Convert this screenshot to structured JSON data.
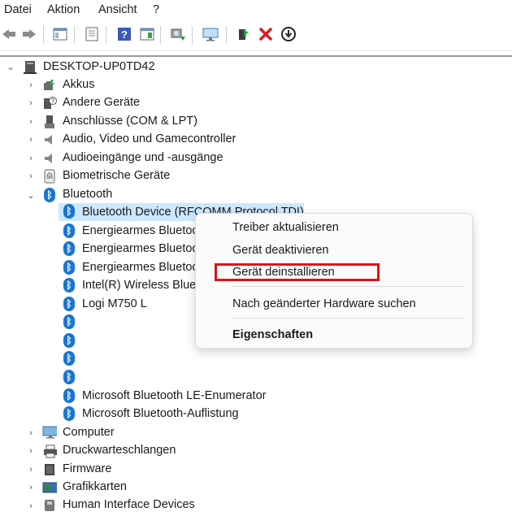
{
  "menu": [
    "Datei",
    "Aktion",
    "Ansicht",
    "?"
  ],
  "tree": {
    "root": "DESKTOP-UP0TD42",
    "categories_before": [
      "Akkus",
      "Andere Geräte",
      "Anschlüsse (COM & LPT)",
      "Audio, Video und Gamecontroller",
      "Audioeingänge und -ausgänge",
      "Biometrische Geräte"
    ],
    "bluetooth": "Bluetooth",
    "bt_children": [
      "Bluetooth Device (RFCOMM Protocol TDI)",
      "Energiearmes Bluetoo",
      "Energiearmes Bluetoo",
      "Energiearmes Bluetoo",
      "Intel(R) Wireless Bluet",
      "Logi M750 L",
      "",
      "",
      "",
      "",
      "Microsoft Bluetooth LE-Enumerator",
      "Microsoft Bluetooth-Auflistung"
    ],
    "categories_after": [
      "Computer",
      "Druckwarteschlangen",
      "Firmware",
      "Grafikkarten",
      "Human Interface Devices"
    ]
  },
  "context_menu": {
    "items": [
      "Treiber aktualisieren",
      "Gerät deaktivieren",
      "Gerät deinstallieren",
      "Nach geänderter Hardware suchen",
      "Eigenschaften"
    ]
  },
  "colors": {
    "highlight_box": "#e0101a",
    "selection": "#cce8ff",
    "bluetooth": "#1976d2"
  }
}
